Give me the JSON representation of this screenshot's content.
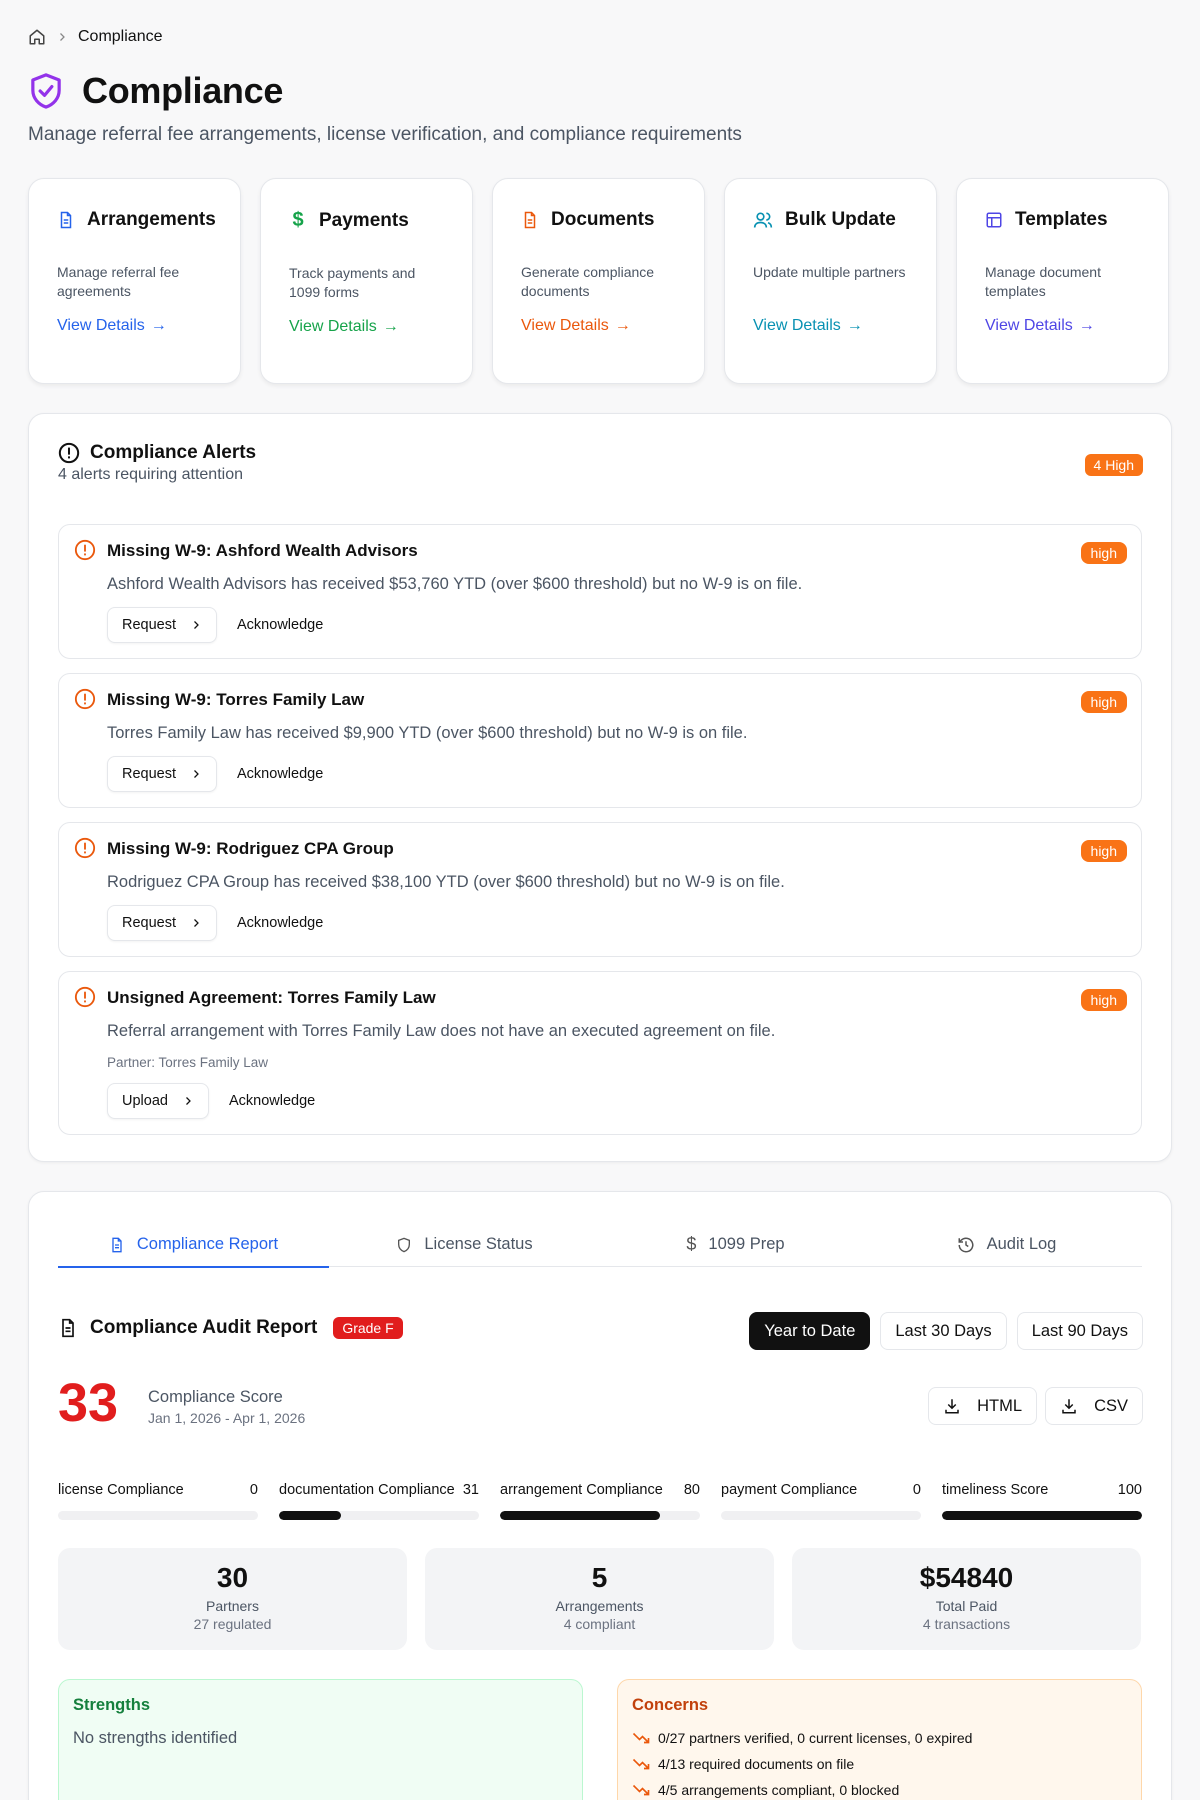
{
  "breadcrumb": {
    "current": "Compliance"
  },
  "header": {
    "title": "Compliance",
    "subtitle": "Manage referral fee arrangements, license verification, and compliance requirements"
  },
  "cards": [
    {
      "title": "Arrangements",
      "desc": "Manage referral fee agreements",
      "link": "View Details",
      "icon": "file-text-icon",
      "color": "#2563eb"
    },
    {
      "title": "Payments",
      "desc": "Track payments and 1099 forms",
      "link": "View Details",
      "icon": "dollar-icon",
      "color": "#16a34a"
    },
    {
      "title": "Documents",
      "desc": "Generate compliance documents",
      "link": "View Details",
      "icon": "document-icon",
      "color": "#ea580c"
    },
    {
      "title": "Bulk Update",
      "desc": "Update multiple partners",
      "link": "View Details",
      "icon": "users-icon",
      "color": "#0891b2"
    },
    {
      "title": "Templates",
      "desc": "Manage document templates",
      "link": "View Details",
      "icon": "layout-icon",
      "color": "#4f46e5"
    }
  ],
  "alerts": {
    "title": "Compliance Alerts",
    "subtitle": "4 alerts requiring attention",
    "count_badge": "4 High",
    "items": [
      {
        "title": "Missing W-9: Ashford Wealth Advisors",
        "desc": "Ashford Wealth Advisors has received $53,760 YTD (over $600 threshold) but no W-9 is on file.",
        "severity": "high",
        "action": "Request",
        "ack": "Acknowledge"
      },
      {
        "title": "Missing W-9: Torres Family Law",
        "desc": "Torres Family Law has received $9,900 YTD (over $600 threshold) but no W-9 is on file.",
        "severity": "high",
        "action": "Request",
        "ack": "Acknowledge"
      },
      {
        "title": "Missing W-9: Rodriguez CPA Group",
        "desc": "Rodriguez CPA Group has received $38,100 YTD (over $600 threshold) but no W-9 is on file.",
        "severity": "high",
        "action": "Request",
        "ack": "Acknowledge"
      },
      {
        "title": "Unsigned Agreement: Torres Family Law",
        "desc": "Referral arrangement with Torres Family Law does not have an executed agreement on file.",
        "partner": "Partner: Torres Family Law",
        "severity": "high",
        "action": "Upload",
        "ack": "Acknowledge"
      }
    ]
  },
  "tabs": [
    {
      "label": "Compliance Report",
      "icon": "file-text-icon",
      "active": true
    },
    {
      "label": "License Status",
      "icon": "shield-icon",
      "active": false
    },
    {
      "label": "1099 Prep",
      "icon": "dollar-icon",
      "active": false
    },
    {
      "label": "Audit Log",
      "icon": "history-icon",
      "active": false
    }
  ],
  "report": {
    "title": "Compliance Audit Report",
    "grade": "Grade F",
    "ranges": [
      {
        "label": "Year to Date",
        "active": true
      },
      {
        "label": "Last 30 Days",
        "active": false
      },
      {
        "label": "Last 90 Days",
        "active": false
      }
    ],
    "score": "33",
    "score_label": "Compliance Score",
    "date_range": "Jan 1, 2026 - Apr 1, 2026",
    "exports": [
      "HTML",
      "CSV"
    ],
    "metrics": [
      {
        "label": "license Compliance",
        "value": 0
      },
      {
        "label": "documentation Compliance",
        "value": 31
      },
      {
        "label": "arrangement Compliance",
        "value": 80
      },
      {
        "label": "payment Compliance",
        "value": 0
      },
      {
        "label": "timeliness Score",
        "value": 100
      }
    ],
    "stats": [
      {
        "value": "30",
        "label": "Partners",
        "sub": "27 regulated"
      },
      {
        "value": "5",
        "label": "Arrangements",
        "sub": "4 compliant"
      },
      {
        "value": "$54840",
        "label": "Total Paid",
        "sub": "4 transactions"
      }
    ],
    "strengths": {
      "title": "Strengths",
      "empty": "No strengths identified"
    },
    "concerns": {
      "title": "Concerns",
      "items": [
        "0/27 partners verified, 0 current licenses, 0 expired",
        "4/13 required documents on file",
        "4/5 arrangements compliant, 0 blocked"
      ]
    }
  }
}
